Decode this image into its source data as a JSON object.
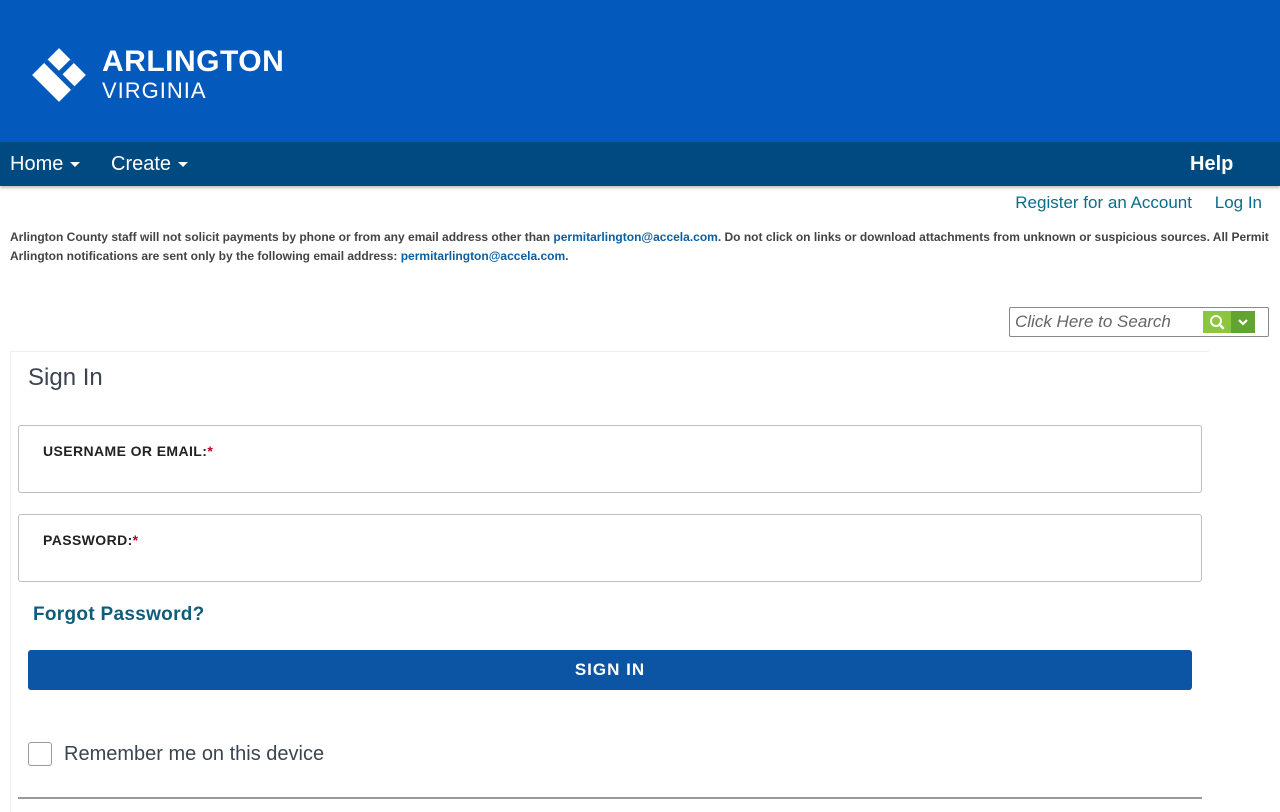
{
  "header": {
    "logo_line1": "ARLINGTON",
    "logo_line2": "VIRGINIA",
    "logo_icon": "arlington-diamond-logo"
  },
  "nav": {
    "home": "Home",
    "create": "Create",
    "help": "Help"
  },
  "account_links": {
    "register": "Register for an Account",
    "login": "Log In"
  },
  "notice": {
    "part1": "Arlington County staff will not solicit payments by phone or from any email address other than ",
    "email1": "permitarlington@accela.com",
    "part2": ".  Do not click on links or download attachments from unknown or suspicious sources.  All Permit Arlington notifications are sent only by the following email address: ",
    "email2": "permitarlington@accela.com",
    "part3": "."
  },
  "search": {
    "placeholder": "Click Here to Search",
    "search_icon": "search-icon",
    "dropdown_icon": "chevron-down-icon"
  },
  "signin": {
    "title": "Sign In",
    "username_label": "USERNAME OR EMAIL:",
    "password_label": "PASSWORD:",
    "required_mark": "*",
    "username_value": "",
    "password_value": "",
    "forgot": "Forgot Password?",
    "button": "SIGN IN",
    "remember": "Remember me on this device",
    "remember_checked": false
  },
  "colors": {
    "banner": "#0359bc",
    "navbar": "#004a82",
    "button": "#0b55a4",
    "search_green": "#8cc63f",
    "link": "#0a6d8c"
  }
}
